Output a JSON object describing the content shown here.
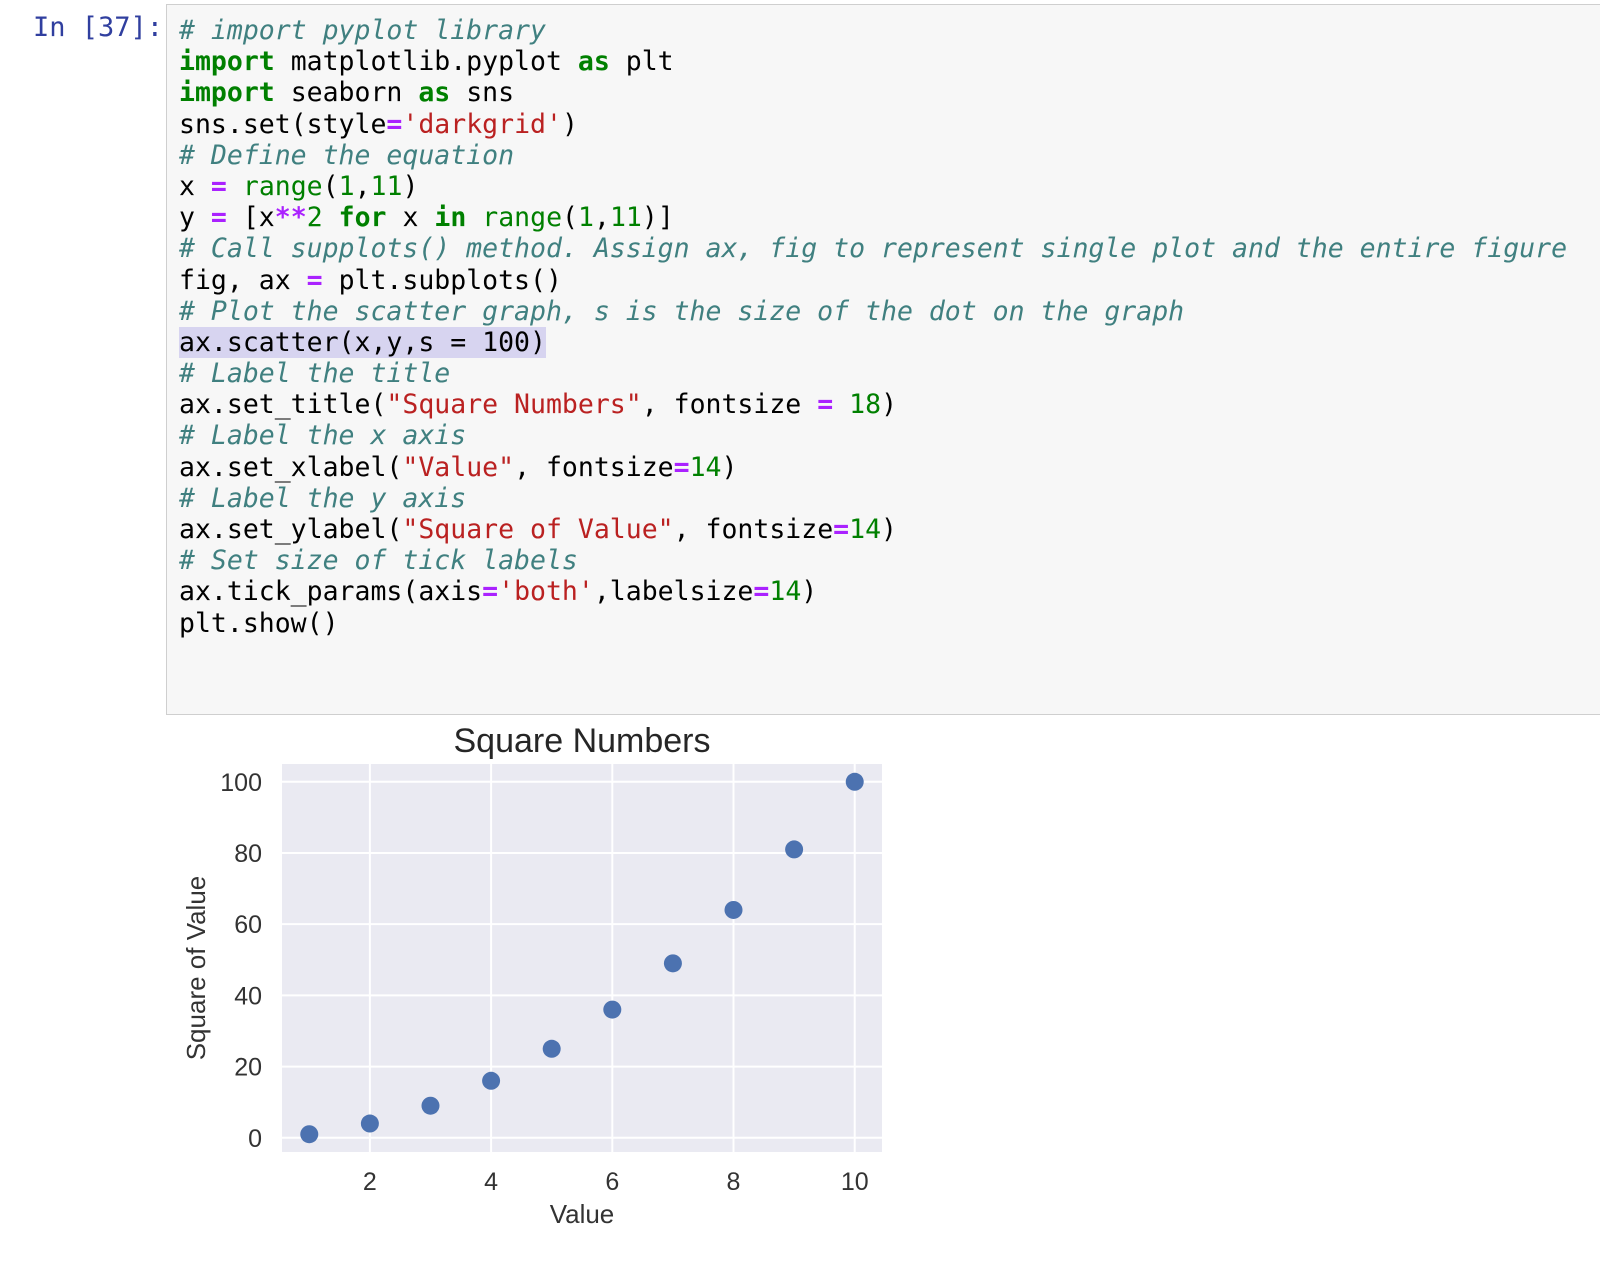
{
  "cell": {
    "prompt": "In [37]:",
    "code": [
      [
        [
          "c",
          "# import pyplot library"
        ]
      ],
      [
        [
          "k",
          "import"
        ],
        [
          "",
          " matplotlib.pyplot "
        ],
        [
          "k",
          "as"
        ],
        [
          "",
          " plt"
        ]
      ],
      [
        [
          "k",
          "import"
        ],
        [
          "",
          " seaborn "
        ],
        [
          "k",
          "as"
        ],
        [
          "",
          " sns"
        ]
      ],
      [
        [
          "",
          "sns.set(style"
        ],
        [
          "o",
          "="
        ],
        [
          "s",
          "'darkgrid'"
        ],
        [
          "",
          ")"
        ]
      ],
      [
        [
          "c",
          "# Define the equation"
        ]
      ],
      [
        [
          "",
          "x "
        ],
        [
          "o",
          "="
        ],
        [
          "",
          " "
        ],
        [
          "b",
          "range"
        ],
        [
          "",
          "("
        ],
        [
          "n",
          "1"
        ],
        [
          "",
          ","
        ],
        [
          "n",
          "11"
        ],
        [
          "",
          ")"
        ]
      ],
      [
        [
          "",
          "y "
        ],
        [
          "o",
          "="
        ],
        [
          "",
          " [x"
        ],
        [
          "o",
          "**"
        ],
        [
          "n",
          "2"
        ],
        [
          "",
          " "
        ],
        [
          "k",
          "for"
        ],
        [
          "",
          " x "
        ],
        [
          "k",
          "in"
        ],
        [
          "",
          " "
        ],
        [
          "b",
          "range"
        ],
        [
          "",
          "("
        ],
        [
          "n",
          "1"
        ],
        [
          "",
          ","
        ],
        [
          "n",
          "11"
        ],
        [
          "",
          ")]"
        ]
      ],
      [
        [
          "c",
          "# Call supplots() method. Assign ax, fig to represent single plot and the entire figure"
        ]
      ],
      [
        [
          "",
          "fig, ax "
        ],
        [
          "o",
          "="
        ],
        [
          "",
          " plt.subplots()"
        ]
      ],
      [
        [
          "c",
          "# Plot the scatter graph, s is the size of the dot on the graph"
        ]
      ],
      [
        [
          "hl",
          "ax.scatter(x,y,s = 100)"
        ]
      ],
      [
        [
          "c",
          "# Label the title"
        ]
      ],
      [
        [
          "",
          "ax.set_title("
        ],
        [
          "s",
          "\"Square Numbers\""
        ],
        [
          "",
          ", fontsize "
        ],
        [
          "o",
          "="
        ],
        [
          "",
          " "
        ],
        [
          "n",
          "18"
        ],
        [
          "",
          ")"
        ]
      ],
      [
        [
          "c",
          "# Label the x axis"
        ]
      ],
      [
        [
          "",
          "ax.set_xlabel("
        ],
        [
          "s",
          "\"Value\""
        ],
        [
          "",
          ", fontsize"
        ],
        [
          "o",
          "="
        ],
        [
          "n",
          "14"
        ],
        [
          "",
          ")"
        ]
      ],
      [
        [
          "c",
          "# Label the y axis"
        ]
      ],
      [
        [
          "",
          "ax.set_ylabel("
        ],
        [
          "s",
          "\"Square of Value\""
        ],
        [
          "",
          ", fontsize"
        ],
        [
          "o",
          "="
        ],
        [
          "n",
          "14"
        ],
        [
          "",
          ")"
        ]
      ],
      [
        [
          "c",
          "# Set size of tick labels"
        ]
      ],
      [
        [
          "",
          "ax.tick_params(axis"
        ],
        [
          "o",
          "="
        ],
        [
          "s",
          "'both'"
        ],
        [
          "",
          ",labelsize"
        ],
        [
          "o",
          "="
        ],
        [
          "n",
          "14"
        ],
        [
          "",
          ")"
        ]
      ],
      [
        [
          "",
          "plt.show()"
        ]
      ]
    ]
  },
  "colors": {
    "prompt": "#303F9F",
    "axes_bg": "#EAEAF2",
    "grid": "#FFFFFF",
    "point": "#4C72B0"
  },
  "chart_data": {
    "type": "scatter",
    "title": "Square Numbers",
    "xlabel": "Value",
    "ylabel": "Square of Value",
    "x": [
      1,
      2,
      3,
      4,
      5,
      6,
      7,
      8,
      9,
      10
    ],
    "y": [
      1,
      4,
      9,
      16,
      25,
      36,
      49,
      64,
      81,
      100
    ],
    "xticks": [
      2,
      4,
      6,
      8,
      10
    ],
    "yticks": [
      0,
      20,
      40,
      60,
      80,
      100
    ],
    "xlim": [
      0.55,
      10.45
    ],
    "ylim": [
      -4.0,
      105.0
    ],
    "grid": true,
    "style": "darkgrid"
  }
}
